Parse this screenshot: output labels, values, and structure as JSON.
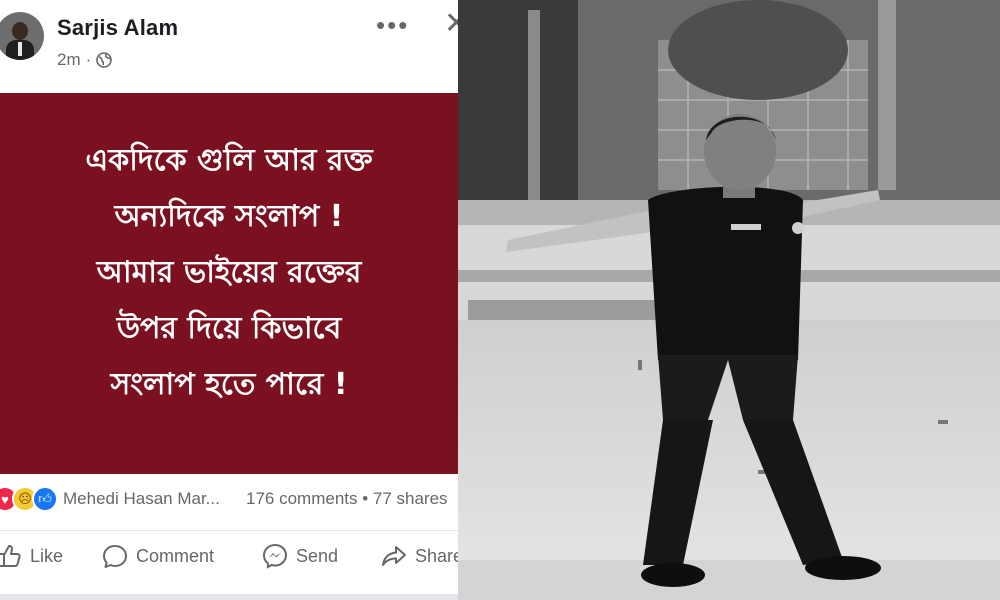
{
  "post": {
    "author": "Sarjis Alam",
    "time": "2m",
    "banner_lines": [
      "একদিকে গুলি আর রক্ত",
      "অন্যদিকে সংলাপ !",
      "আমার ভাইয়ের রক্তের",
      "উপর দিয়ে কিভাবে",
      "সংলাপ হতে পারে !"
    ],
    "banner_color": "#7b1021",
    "reactor_text": "Mehedi Hasan Mar...",
    "counts_text": "176 comments • 77 shares",
    "actions": {
      "like": "Like",
      "comment": "Comment",
      "send": "Send",
      "share": "Share"
    }
  },
  "icons": [
    "more-options-icon",
    "close-icon",
    "globe-icon",
    "love-reaction-icon",
    "sad-reaction-icon",
    "like-reaction-icon",
    "like-icon",
    "comment-icon",
    "messenger-icon",
    "share-icon"
  ]
}
